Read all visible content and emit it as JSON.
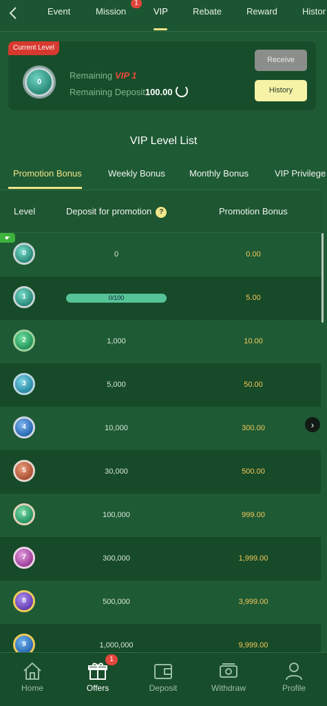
{
  "nav": {
    "back_label": "<",
    "tabs": [
      "Event",
      "Mission",
      "VIP",
      "Rebate",
      "Reward",
      "Histor"
    ],
    "mission_badge": "1",
    "active_tab": "VIP"
  },
  "current_level": {
    "tag": "Current Level",
    "badge_level": "0",
    "remaining_label": "Remaining",
    "remaining_vip": "VIP 1",
    "deposit_label": "Remaining Deposit",
    "deposit_value": "100.00",
    "receive_label": "Receive",
    "history_label": "History"
  },
  "list": {
    "title": "VIP Level List",
    "subtabs": [
      "Promotion Bonus",
      "Weekly Bonus",
      "Monthly Bonus",
      "VIP Privilege"
    ],
    "headers": {
      "level": "Level",
      "deposit": "Deposit for promotion",
      "bonus": "Promotion Bonus",
      "help": "?"
    },
    "progress_text": "0/100",
    "rows": [
      {
        "level": "0",
        "deposit": "0",
        "bonus": "0.00"
      },
      {
        "level": "1",
        "deposit": "",
        "bonus": "5.00"
      },
      {
        "level": "2",
        "deposit": "1,000",
        "bonus": "10.00"
      },
      {
        "level": "3",
        "deposit": "5,000",
        "bonus": "50.00"
      },
      {
        "level": "4",
        "deposit": "10,000",
        "bonus": "300.00"
      },
      {
        "level": "5",
        "deposit": "30,000",
        "bonus": "500.00"
      },
      {
        "level": "6",
        "deposit": "100,000",
        "bonus": "999.00"
      },
      {
        "level": "7",
        "deposit": "300,000",
        "bonus": "1,999.00"
      },
      {
        "level": "8",
        "deposit": "500,000",
        "bonus": "3,999.00"
      },
      {
        "level": "9",
        "deposit": "1,000,000",
        "bonus": "9,999.00"
      }
    ]
  },
  "bottom_nav": {
    "items": [
      "Home",
      "Offers",
      "Deposit",
      "Withdraw",
      "Profile"
    ],
    "offers_badge": "1",
    "active": "Offers"
  },
  "colors": {
    "bg": "#1e5a34",
    "accent": "#f1e58b",
    "bonus": "#f4c95c",
    "badge": "#e2453c"
  }
}
